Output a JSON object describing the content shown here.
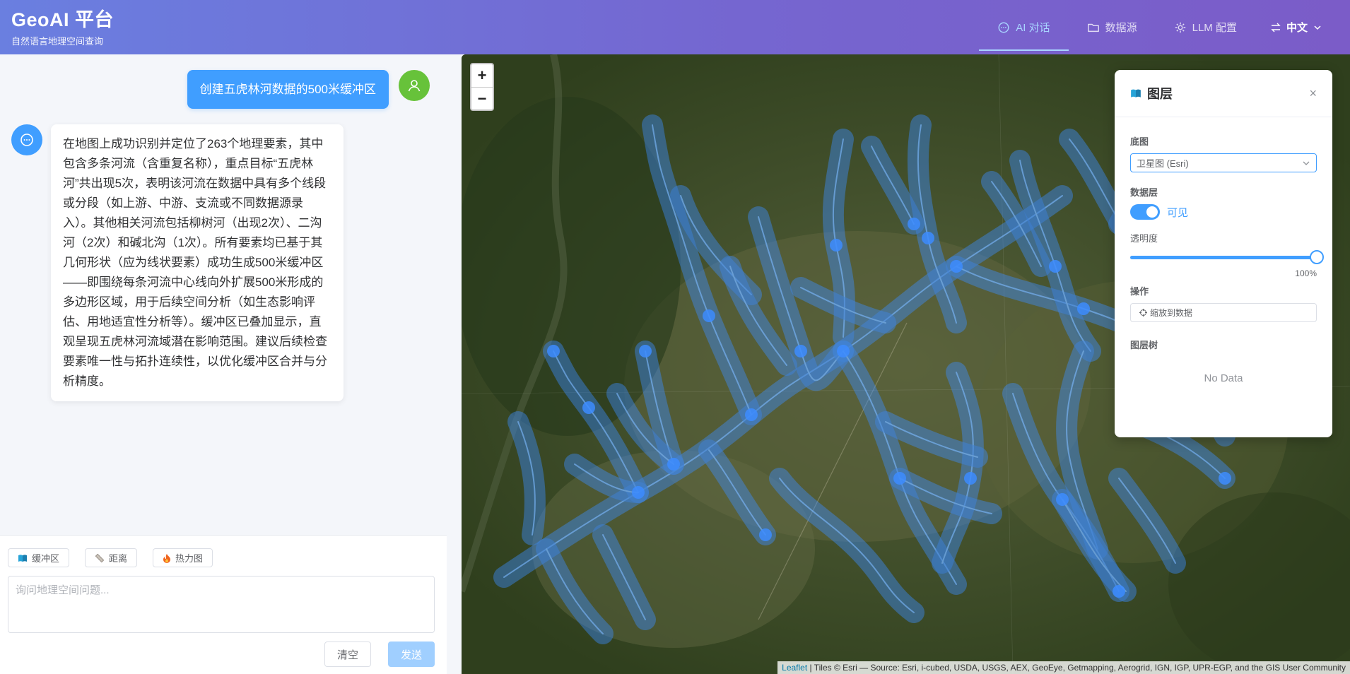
{
  "header": {
    "title": "GeoAI 平台",
    "subtitle": "自然语言地理空间查询",
    "nav": [
      {
        "label": "AI 对话",
        "icon": "chat-icon",
        "active": true
      },
      {
        "label": "数据源",
        "icon": "folder-icon",
        "active": false
      },
      {
        "label": "LLM 配置",
        "icon": "gear-icon",
        "active": false
      }
    ],
    "language": "中文"
  },
  "chat": {
    "user_message": "创建五虎林河数据的500米缓冲区",
    "ai_message": "在地图上成功识别并定位了263个地理要素，其中包含多条河流（含重复名称），重点目标“五虎林河”共出现5次，表明该河流在数据中具有多个线段或分段（如上游、中游、支流或不同数据源录入）。其他相关河流包括柳树河（出现2次）、二沟河（2次）和碱北沟（1次）。所有要素均已基于其几何形状（应为线状要素）成功生成500米缓冲区——即围绕每条河流中心线向外扩展500米形成的多边形区域，用于后续空间分析（如生态影响评估、用地适宜性分析等）。缓冲区已叠加显示，直观呈现五虎林河流域潜在影响范围。建议后续检查要素唯一性与拓扑连续性，以优化缓冲区合并与分析精度。",
    "quick_actions": [
      {
        "label": "缓冲区",
        "icon": "book-icon"
      },
      {
        "label": "距离",
        "icon": "ruler-icon"
      },
      {
        "label": "热力图",
        "icon": "fire-icon"
      }
    ],
    "input_placeholder": "询问地理空间问题...",
    "clear_label": "清空",
    "send_label": "发送"
  },
  "map": {
    "zoom_in": "+",
    "zoom_out": "−",
    "attribution_link": "Leaflet",
    "attribution_text": " | Tiles © Esri — Source: Esri, i-cubed, USDA, USGS, AEX, GeoEye, Getmapping, Aerogrid, IGN, IGP, UPR-EGP, and the GIS User Community",
    "buffer_color": "#3d8cff"
  },
  "layers": {
    "title": "图层",
    "close": "×",
    "basemap_label": "底图",
    "basemap_value": "卫星图 (Esri)",
    "datalayer_label": "数据层",
    "visible_label": "可见",
    "visible": true,
    "opacity_label": "透明度",
    "opacity": 1.0,
    "opacity_text": "100%",
    "actions_label": "操作",
    "zoom_to_data": "缩放到数据",
    "tree_label": "图层树",
    "no_data": "No Data"
  }
}
